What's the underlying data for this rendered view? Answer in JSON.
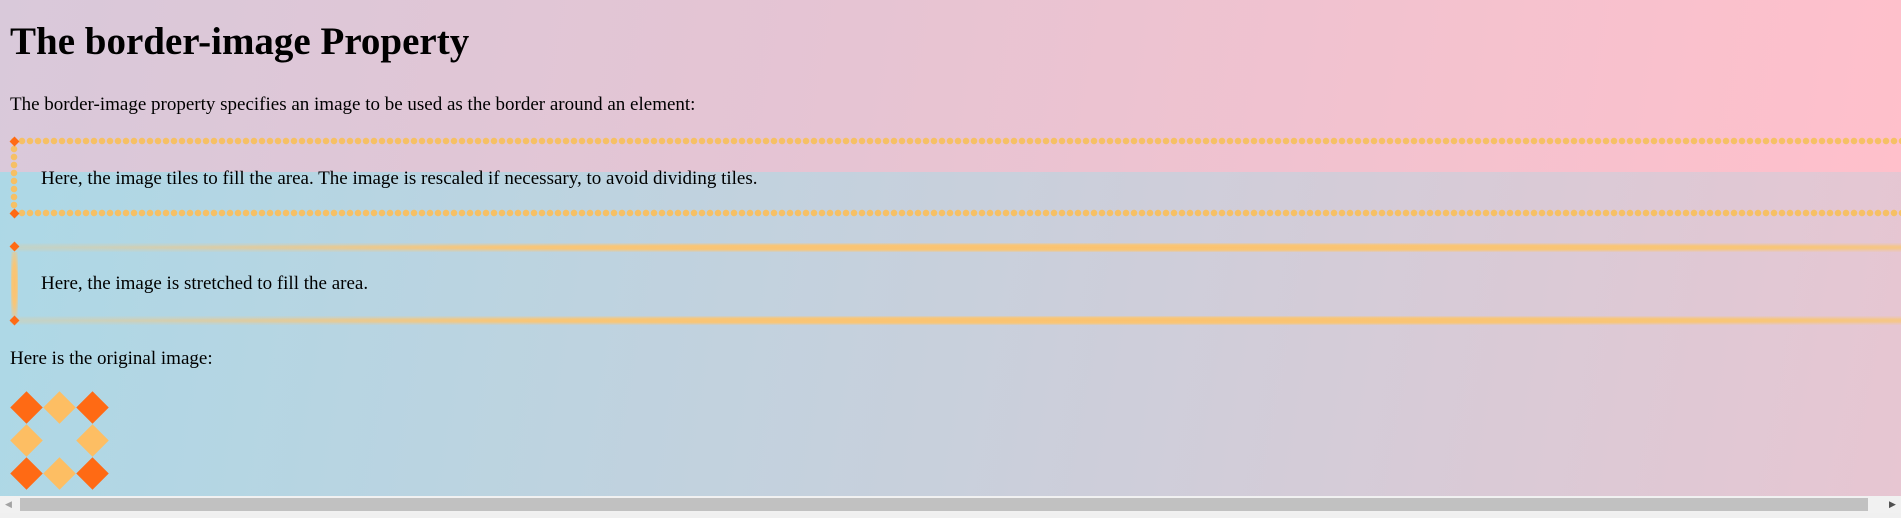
{
  "page": {
    "title": "The border-image Property",
    "intro": "The border-image property specifies an image to be used as the border around an element:"
  },
  "boxes": [
    {
      "text": "Here, the image tiles to fill the area. The image is rescaled if necessary, to avoid dividing tiles.",
      "mode": "round"
    },
    {
      "text": "Here, the image is stretched to fill the area.",
      "mode": "stretch"
    }
  ],
  "original": {
    "label": "Here is the original image:",
    "image_icon": "diamond-pattern-image"
  },
  "colors": {
    "corner_orange": "#ff6a14",
    "tile_light": "#fdbe63",
    "gradient_pink": "#ffc0cb",
    "gradient_blue": "#add8e6"
  },
  "scrollbar": {
    "left_arrow": "◀",
    "right_arrow": "▶"
  }
}
